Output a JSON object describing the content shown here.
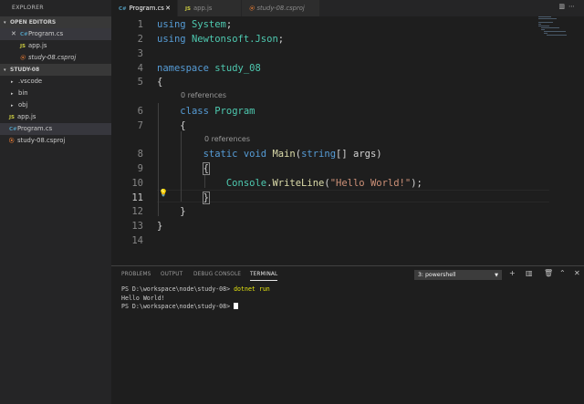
{
  "sidebar": {
    "title": "EXPLORER",
    "open_editors": {
      "header": "OPEN EDITORS",
      "items": [
        {
          "label": "Program.cs",
          "icon": "csharp-icon"
        },
        {
          "label": "app.js",
          "icon": "js-icon"
        },
        {
          "label": "study-08.csproj",
          "icon": "rss-xml-icon"
        }
      ]
    },
    "folder": {
      "header": "STUDY-08",
      "items": [
        {
          "label": ".vscode"
        },
        {
          "label": "bin"
        },
        {
          "label": "obj"
        },
        {
          "label": "app.js",
          "icon": "js-icon"
        },
        {
          "label": "Program.cs",
          "icon": "csharp-icon"
        },
        {
          "label": "study-08.csproj",
          "icon": "rss-xml-icon"
        }
      ]
    }
  },
  "tabs": [
    {
      "label": "Program.cs",
      "active": true
    },
    {
      "label": "app.js",
      "active": false
    },
    {
      "label": "study-08.csproj",
      "active": false
    }
  ],
  "editor": {
    "line_numbers": [
      "1",
      "2",
      "3",
      "4",
      "5",
      "6",
      "7",
      "8",
      "9",
      "10",
      "11",
      "12",
      "13",
      "14"
    ],
    "code_lens": [
      "0 references",
      "0 references"
    ],
    "current_line": "11"
  },
  "panel": {
    "tabs": [
      "PROBLEMS",
      "OUTPUT",
      "DEBUG CONSOLE",
      "TERMINAL"
    ],
    "active_tab": "TERMINAL",
    "terminal_select": "3: powershell",
    "terminal_lines": [
      {
        "prompt": "PS D:\\workspace\\node\\study-08>",
        "command": "dotnet run"
      },
      {
        "output": "Hello World!"
      },
      {
        "prompt": "PS D:\\workspace\\node\\study-08>",
        "command": ""
      }
    ]
  },
  "colors": {
    "keyword": "#569cd6",
    "type": "#4ec9b0",
    "function": "#dcdcaa",
    "string": "#ce9178",
    "csharp_icon": "#519aba",
    "js_icon": "#cbcb41",
    "xml_icon": "#e37933"
  }
}
